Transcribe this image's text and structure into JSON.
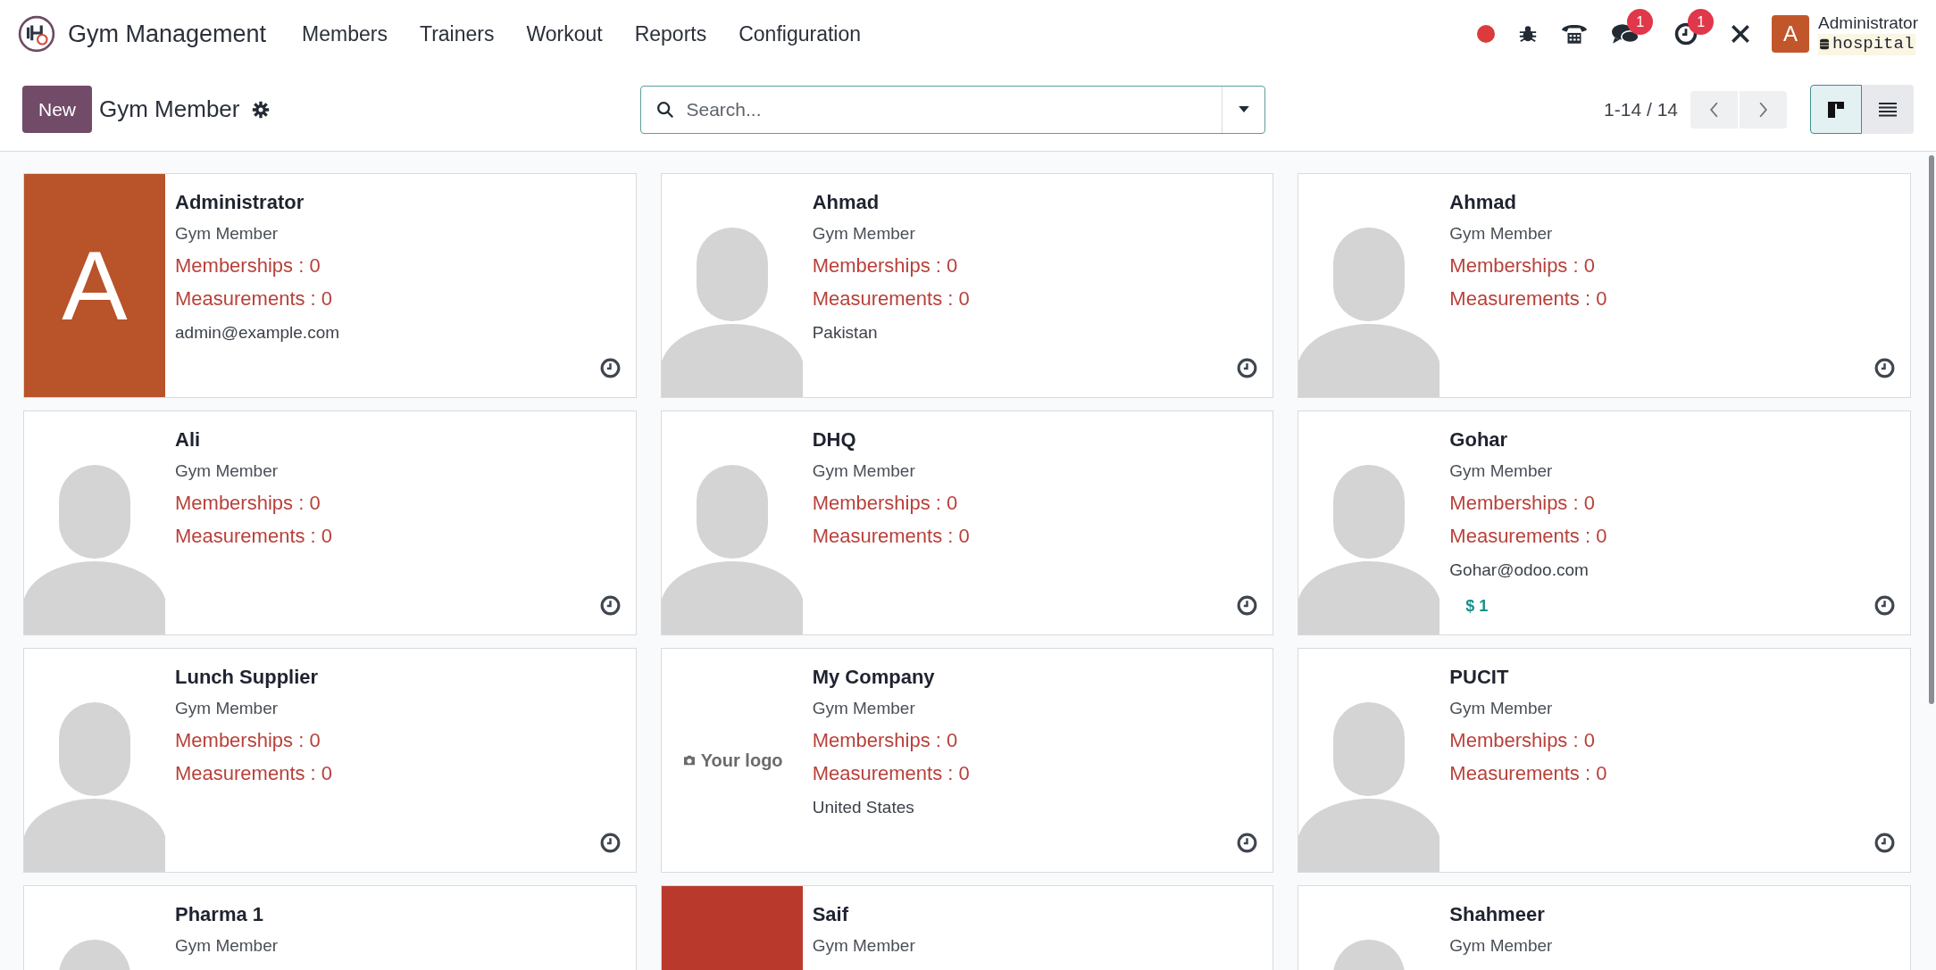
{
  "navbar": {
    "app_name": "Gym Management",
    "menus": [
      "Members",
      "Trainers",
      "Workout",
      "Reports",
      "Configuration"
    ],
    "chat_badge": "1",
    "activity_badge": "1",
    "user": {
      "avatar_letter": "A",
      "name": "Administrator",
      "database": "hospital"
    }
  },
  "control_panel": {
    "new_button": "New",
    "title": "Gym Member",
    "search": {
      "placeholder": "Search..."
    },
    "pager": "1-14 / 14",
    "views": [
      {
        "kind": "kanban",
        "selected": true
      },
      {
        "kind": "list",
        "selected": false
      }
    ]
  },
  "cards": [
    {
      "name": "Administrator",
      "subtitle": "Gym Member",
      "avatar": {
        "kind": "letter",
        "letter": "A",
        "color": "#b8532a"
      },
      "memberships": "Memberships : 0",
      "measurements": "Measurements : 0",
      "detail": "admin@example.com"
    },
    {
      "name": "Ahmad",
      "subtitle": "Gym Member",
      "avatar": {
        "kind": "placeholder"
      },
      "memberships": "Memberships : 0",
      "measurements": "Measurements : 0",
      "detail": "Pakistan"
    },
    {
      "name": "Ahmad",
      "subtitle": "Gym Member",
      "avatar": {
        "kind": "placeholder"
      },
      "memberships": "Memberships : 0",
      "measurements": "Measurements : 0"
    },
    {
      "name": "Ali",
      "subtitle": "Gym Member",
      "avatar": {
        "kind": "placeholder"
      },
      "memberships": "Memberships : 0",
      "measurements": "Measurements : 0"
    },
    {
      "name": "DHQ",
      "subtitle": "Gym Member",
      "avatar": {
        "kind": "placeholder"
      },
      "memberships": "Memberships : 0",
      "measurements": "Measurements : 0"
    },
    {
      "name": "Gohar",
      "subtitle": "Gym Member",
      "avatar": {
        "kind": "placeholder"
      },
      "memberships": "Memberships : 0",
      "measurements": "Measurements : 0",
      "detail": "Gohar@odoo.com",
      "tag": "$ 1"
    },
    {
      "name": "Lunch Supplier",
      "subtitle": "Gym Member",
      "avatar": {
        "kind": "placeholder"
      },
      "memberships": "Memberships : 0",
      "measurements": "Measurements : 0"
    },
    {
      "name": "My Company",
      "subtitle": "Gym Member",
      "avatar": {
        "kind": "logo",
        "text": "Your logo"
      },
      "memberships": "Memberships : 0",
      "measurements": "Measurements : 0",
      "detail": "United States"
    },
    {
      "name": "PUCIT",
      "subtitle": "Gym Member",
      "avatar": {
        "kind": "placeholder"
      },
      "memberships": "Memberships : 0",
      "measurements": "Measurements : 0"
    },
    {
      "name": "Pharma 1",
      "subtitle": "Gym Member",
      "avatar": {
        "kind": "placeholder"
      }
    },
    {
      "name": "Saif",
      "subtitle": "Gym Member",
      "avatar": {
        "kind": "letter",
        "color": "#b93a2c"
      }
    },
    {
      "name": "Shahmeer",
      "subtitle": "Gym Member",
      "avatar": {
        "kind": "placeholder"
      }
    }
  ]
}
